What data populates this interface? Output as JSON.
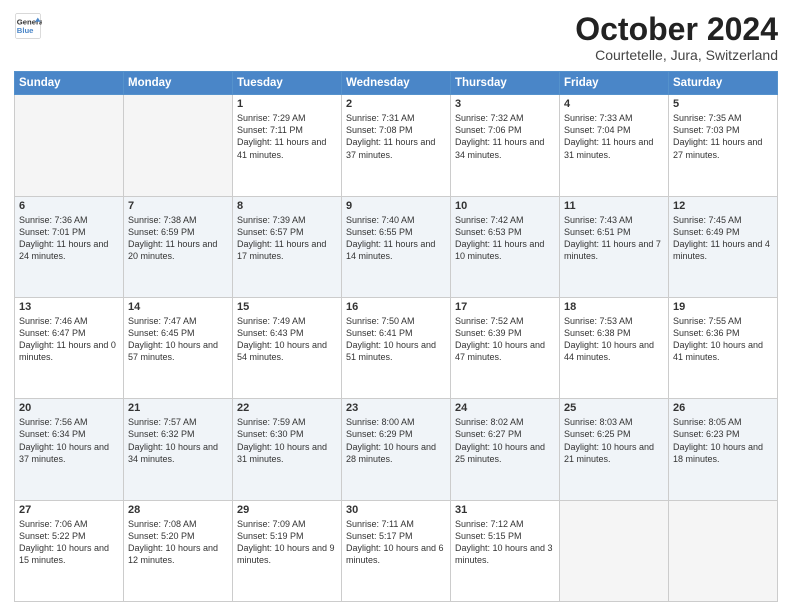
{
  "header": {
    "logo_line1": "General",
    "logo_line2": "Blue",
    "month": "October 2024",
    "location": "Courtetelle, Jura, Switzerland"
  },
  "days_of_week": [
    "Sunday",
    "Monday",
    "Tuesday",
    "Wednesday",
    "Thursday",
    "Friday",
    "Saturday"
  ],
  "weeks": [
    [
      {
        "day": "",
        "empty": true
      },
      {
        "day": "",
        "empty": true
      },
      {
        "day": "1",
        "sunrise": "Sunrise: 7:29 AM",
        "sunset": "Sunset: 7:11 PM",
        "daylight": "Daylight: 11 hours and 41 minutes."
      },
      {
        "day": "2",
        "sunrise": "Sunrise: 7:31 AM",
        "sunset": "Sunset: 7:08 PM",
        "daylight": "Daylight: 11 hours and 37 minutes."
      },
      {
        "day": "3",
        "sunrise": "Sunrise: 7:32 AM",
        "sunset": "Sunset: 7:06 PM",
        "daylight": "Daylight: 11 hours and 34 minutes."
      },
      {
        "day": "4",
        "sunrise": "Sunrise: 7:33 AM",
        "sunset": "Sunset: 7:04 PM",
        "daylight": "Daylight: 11 hours and 31 minutes."
      },
      {
        "day": "5",
        "sunrise": "Sunrise: 7:35 AM",
        "sunset": "Sunset: 7:03 PM",
        "daylight": "Daylight: 11 hours and 27 minutes."
      }
    ],
    [
      {
        "day": "6",
        "sunrise": "Sunrise: 7:36 AM",
        "sunset": "Sunset: 7:01 PM",
        "daylight": "Daylight: 11 hours and 24 minutes."
      },
      {
        "day": "7",
        "sunrise": "Sunrise: 7:38 AM",
        "sunset": "Sunset: 6:59 PM",
        "daylight": "Daylight: 11 hours and 20 minutes."
      },
      {
        "day": "8",
        "sunrise": "Sunrise: 7:39 AM",
        "sunset": "Sunset: 6:57 PM",
        "daylight": "Daylight: 11 hours and 17 minutes."
      },
      {
        "day": "9",
        "sunrise": "Sunrise: 7:40 AM",
        "sunset": "Sunset: 6:55 PM",
        "daylight": "Daylight: 11 hours and 14 minutes."
      },
      {
        "day": "10",
        "sunrise": "Sunrise: 7:42 AM",
        "sunset": "Sunset: 6:53 PM",
        "daylight": "Daylight: 11 hours and 10 minutes."
      },
      {
        "day": "11",
        "sunrise": "Sunrise: 7:43 AM",
        "sunset": "Sunset: 6:51 PM",
        "daylight": "Daylight: 11 hours and 7 minutes."
      },
      {
        "day": "12",
        "sunrise": "Sunrise: 7:45 AM",
        "sunset": "Sunset: 6:49 PM",
        "daylight": "Daylight: 11 hours and 4 minutes."
      }
    ],
    [
      {
        "day": "13",
        "sunrise": "Sunrise: 7:46 AM",
        "sunset": "Sunset: 6:47 PM",
        "daylight": "Daylight: 11 hours and 0 minutes."
      },
      {
        "day": "14",
        "sunrise": "Sunrise: 7:47 AM",
        "sunset": "Sunset: 6:45 PM",
        "daylight": "Daylight: 10 hours and 57 minutes."
      },
      {
        "day": "15",
        "sunrise": "Sunrise: 7:49 AM",
        "sunset": "Sunset: 6:43 PM",
        "daylight": "Daylight: 10 hours and 54 minutes."
      },
      {
        "day": "16",
        "sunrise": "Sunrise: 7:50 AM",
        "sunset": "Sunset: 6:41 PM",
        "daylight": "Daylight: 10 hours and 51 minutes."
      },
      {
        "day": "17",
        "sunrise": "Sunrise: 7:52 AM",
        "sunset": "Sunset: 6:39 PM",
        "daylight": "Daylight: 10 hours and 47 minutes."
      },
      {
        "day": "18",
        "sunrise": "Sunrise: 7:53 AM",
        "sunset": "Sunset: 6:38 PM",
        "daylight": "Daylight: 10 hours and 44 minutes."
      },
      {
        "day": "19",
        "sunrise": "Sunrise: 7:55 AM",
        "sunset": "Sunset: 6:36 PM",
        "daylight": "Daylight: 10 hours and 41 minutes."
      }
    ],
    [
      {
        "day": "20",
        "sunrise": "Sunrise: 7:56 AM",
        "sunset": "Sunset: 6:34 PM",
        "daylight": "Daylight: 10 hours and 37 minutes."
      },
      {
        "day": "21",
        "sunrise": "Sunrise: 7:57 AM",
        "sunset": "Sunset: 6:32 PM",
        "daylight": "Daylight: 10 hours and 34 minutes."
      },
      {
        "day": "22",
        "sunrise": "Sunrise: 7:59 AM",
        "sunset": "Sunset: 6:30 PM",
        "daylight": "Daylight: 10 hours and 31 minutes."
      },
      {
        "day": "23",
        "sunrise": "Sunrise: 8:00 AM",
        "sunset": "Sunset: 6:29 PM",
        "daylight": "Daylight: 10 hours and 28 minutes."
      },
      {
        "day": "24",
        "sunrise": "Sunrise: 8:02 AM",
        "sunset": "Sunset: 6:27 PM",
        "daylight": "Daylight: 10 hours and 25 minutes."
      },
      {
        "day": "25",
        "sunrise": "Sunrise: 8:03 AM",
        "sunset": "Sunset: 6:25 PM",
        "daylight": "Daylight: 10 hours and 21 minutes."
      },
      {
        "day": "26",
        "sunrise": "Sunrise: 8:05 AM",
        "sunset": "Sunset: 6:23 PM",
        "daylight": "Daylight: 10 hours and 18 minutes."
      }
    ],
    [
      {
        "day": "27",
        "sunrise": "Sunrise: 7:06 AM",
        "sunset": "Sunset: 5:22 PM",
        "daylight": "Daylight: 10 hours and 15 minutes."
      },
      {
        "day": "28",
        "sunrise": "Sunrise: 7:08 AM",
        "sunset": "Sunset: 5:20 PM",
        "daylight": "Daylight: 10 hours and 12 minutes."
      },
      {
        "day": "29",
        "sunrise": "Sunrise: 7:09 AM",
        "sunset": "Sunset: 5:19 PM",
        "daylight": "Daylight: 10 hours and 9 minutes."
      },
      {
        "day": "30",
        "sunrise": "Sunrise: 7:11 AM",
        "sunset": "Sunset: 5:17 PM",
        "daylight": "Daylight: 10 hours and 6 minutes."
      },
      {
        "day": "31",
        "sunrise": "Sunrise: 7:12 AM",
        "sunset": "Sunset: 5:15 PM",
        "daylight": "Daylight: 10 hours and 3 minutes."
      },
      {
        "day": "",
        "empty": true
      },
      {
        "day": "",
        "empty": true
      }
    ]
  ]
}
